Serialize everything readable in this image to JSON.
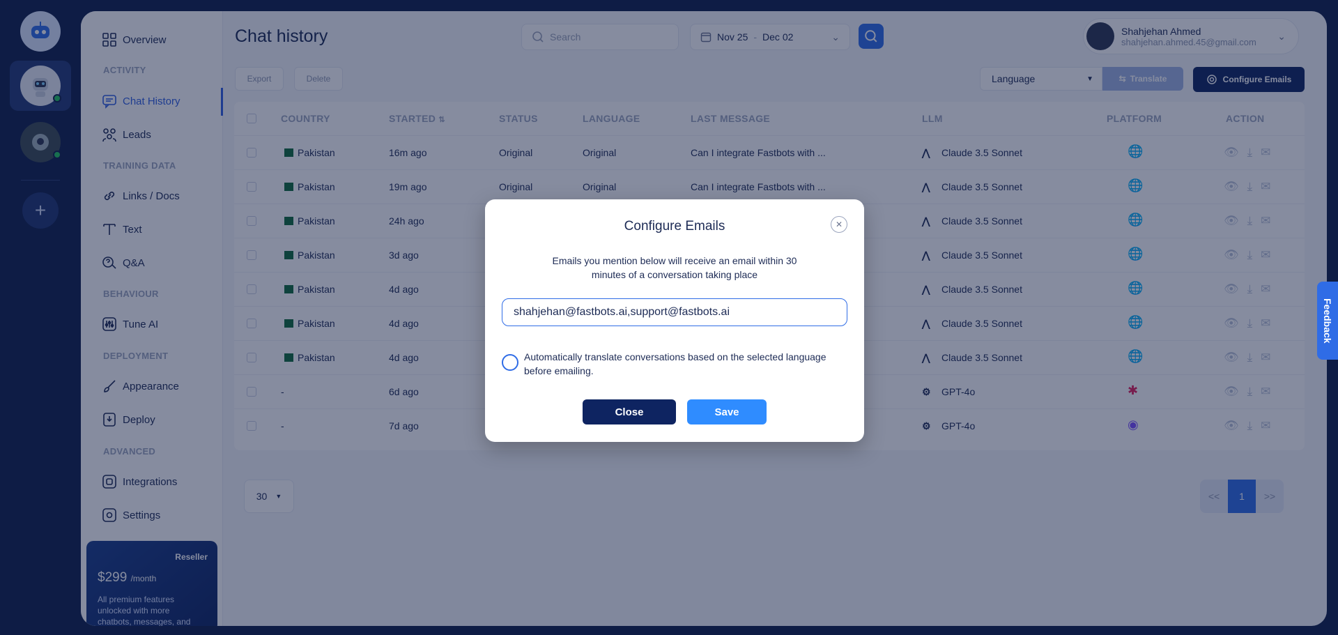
{
  "sidebar": {
    "sections": {
      "activity": "ACTIVITY",
      "training": "TRAINING DATA",
      "behaviour": "BEHAVIOUR",
      "deployment": "DEPLOYMENT",
      "advanced": "ADVANCED"
    },
    "items": [
      {
        "label": "Overview",
        "icon": "grid-icon"
      },
      {
        "label": "Chat History",
        "icon": "chat-icon"
      },
      {
        "label": "Leads",
        "icon": "leads-icon"
      },
      {
        "label": "Links / Docs",
        "icon": "link-icon"
      },
      {
        "label": "Text",
        "icon": "text-icon"
      },
      {
        "label": "Q&A",
        "icon": "qa-icon"
      },
      {
        "label": "Tune AI",
        "icon": "tune-icon"
      },
      {
        "label": "Appearance",
        "icon": "brush-icon"
      },
      {
        "label": "Deploy",
        "icon": "deploy-icon"
      },
      {
        "label": "Integrations",
        "icon": "integrations-icon"
      },
      {
        "label": "Settings",
        "icon": "settings-icon"
      }
    ],
    "promo": {
      "tag": "Reseller",
      "price": "$299",
      "period": "/month",
      "desc": "All premium features unlocked with more chatbots, messages, and"
    }
  },
  "header": {
    "title": "Chat history",
    "search_placeholder": "Search",
    "date_from": "Nov 25",
    "date_sep": "-",
    "date_to": "Dec 02",
    "user_name": "Shahjehan Ahmed",
    "user_email": "shahjehan.ahmed.45@gmail.com"
  },
  "toolbar": {
    "export": "Export",
    "delete": "Delete",
    "language": "Language",
    "translate": "Translate",
    "configure": "Configure Emails"
  },
  "table": {
    "headers": [
      "COUNTRY",
      "STARTED",
      "STATUS",
      "LANGUAGE",
      "LAST MESSAGE",
      "LLM",
      "PLATFORM",
      "ACTION"
    ],
    "rows": [
      {
        "country": "Pakistan",
        "started": "16m ago",
        "status": "Original",
        "language": "Original",
        "last": "Can I integrate Fastbots with ...",
        "llm": "Claude 3.5 Sonnet",
        "platform": "web"
      },
      {
        "country": "Pakistan",
        "started": "19m ago",
        "status": "Original",
        "language": "Original",
        "last": "Can I integrate Fastbots with ...",
        "llm": "Claude 3.5 Sonnet",
        "platform": "web"
      },
      {
        "country": "Pakistan",
        "started": "24h ago",
        "status": "",
        "language": "",
        "last": "",
        "llm": "Claude 3.5 Sonnet",
        "platform": "web"
      },
      {
        "country": "Pakistan",
        "started": "3d ago",
        "status": "",
        "language": "",
        "last": "",
        "llm": "Claude 3.5 Sonnet",
        "platform": "web"
      },
      {
        "country": "Pakistan",
        "started": "4d ago",
        "status": "",
        "language": "",
        "last": "",
        "llm": "Claude 3.5 Sonnet",
        "platform": "web"
      },
      {
        "country": "Pakistan",
        "started": "4d ago",
        "status": "",
        "language": "",
        "last": "",
        "llm": "Claude 3.5 Sonnet",
        "platform": "web"
      },
      {
        "country": "Pakistan",
        "started": "4d ago",
        "status": "",
        "language": "",
        "last": "",
        "llm": "Claude 3.5 Sonnet",
        "platform": "web"
      },
      {
        "country": "-",
        "started": "6d ago",
        "status": "",
        "language": "",
        "last": "",
        "llm": "GPT-4o",
        "platform": "slack"
      },
      {
        "country": "-",
        "started": "7d ago",
        "status": "",
        "language": "",
        "last": "",
        "llm": "GPT-4o",
        "platform": "messenger"
      }
    ]
  },
  "pagination": {
    "per_page": "30",
    "prev": "<<",
    "current": "1",
    "next": ">>"
  },
  "feedback": "Feedback",
  "modal": {
    "title": "Configure Emails",
    "description": "Emails you mention below will receive an email within 30 minutes of a conversation taking place",
    "email_value": "shahjehan@fastbots.ai,support@fastbots.ai",
    "translate_label": "Automatically translate conversations based on the selected language before emailing.",
    "close": "Close",
    "save": "Save"
  }
}
